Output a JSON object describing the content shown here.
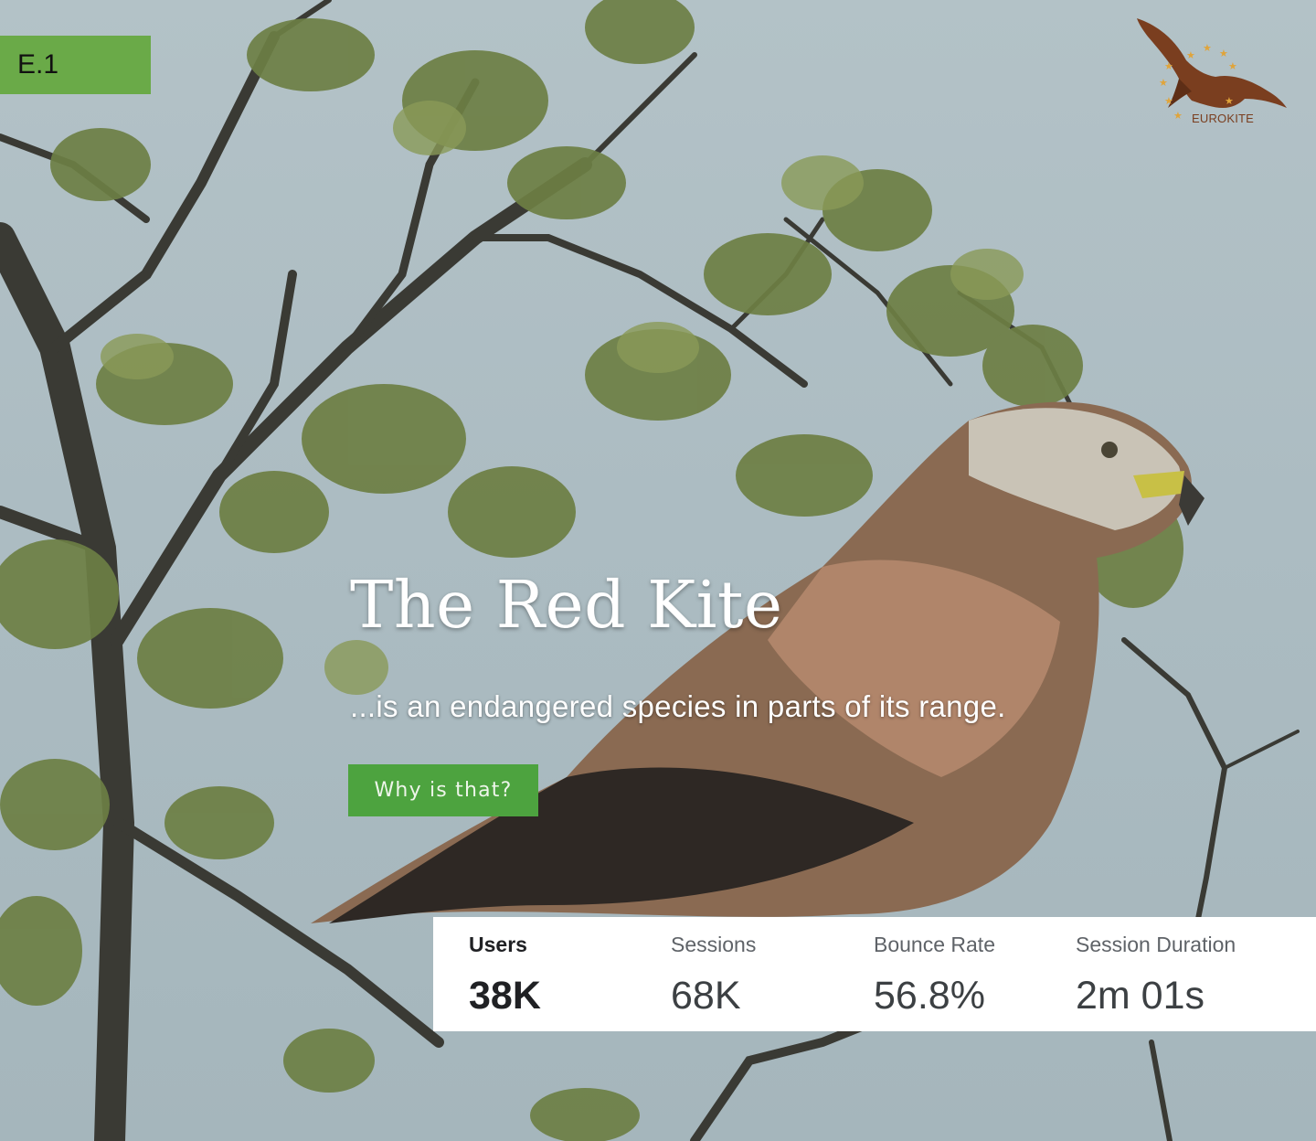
{
  "slide_tag": "E.1",
  "logo": {
    "text": "EUROKITE",
    "icon": "kite-bird-logo-icon",
    "color": "#7a3e1f",
    "star_color": "#e0a43a"
  },
  "hero": {
    "title": "The Red Kite",
    "subtitle": "...is an endangered species in parts of its range.",
    "button_label": "Why is that?",
    "button_color": "#4da33f"
  },
  "tag_color": "#6aaa48",
  "stats": [
    {
      "label": "Users",
      "value": "38K",
      "active": true
    },
    {
      "label": "Sessions",
      "value": "68K",
      "active": false
    },
    {
      "label": "Bounce Rate",
      "value": "56.8%",
      "active": false
    },
    {
      "label": "Session Duration",
      "value": "2m 01s",
      "active": false
    }
  ]
}
